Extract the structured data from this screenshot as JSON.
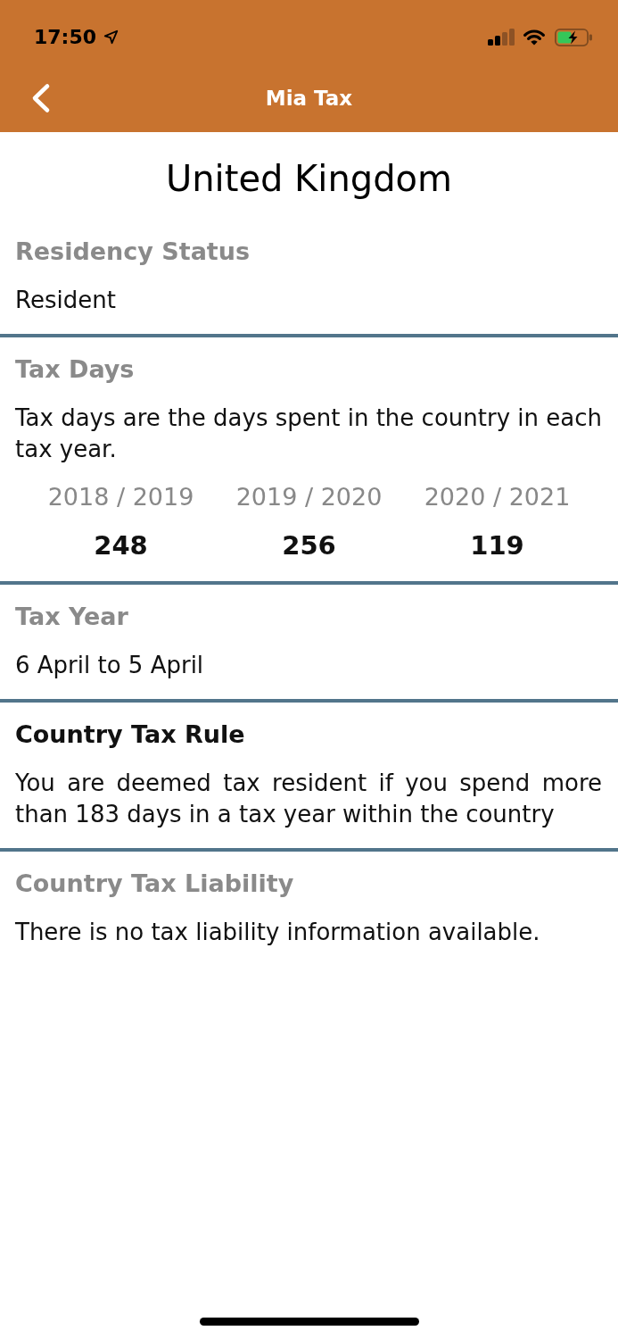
{
  "status_bar": {
    "time": "17:50"
  },
  "nav_bar": {
    "title": "Mia Tax"
  },
  "page_title": "United Kingdom",
  "sections": [
    {
      "heading": "Residency Status",
      "emphasized": false,
      "text": "Resident"
    },
    {
      "heading": "Tax Days",
      "emphasized": false,
      "text": "Tax days are the days spent in the country in each tax year.",
      "years": [
        {
          "label": "2018 / 2019",
          "days": "248"
        },
        {
          "label": "2019 / 2020",
          "days": "256"
        },
        {
          "label": "2020 / 2021",
          "days": "119"
        }
      ]
    },
    {
      "heading": "Tax Year",
      "emphasized": false,
      "text": "6 April to 5 April"
    },
    {
      "heading": "Country Tax Rule",
      "emphasized": true,
      "text": "You are deemed tax resident if you spend more than 183 days in a tax year within the country"
    },
    {
      "heading": "Country Tax Liability",
      "emphasized": false,
      "text": "There is no tax liability information available."
    }
  ]
}
